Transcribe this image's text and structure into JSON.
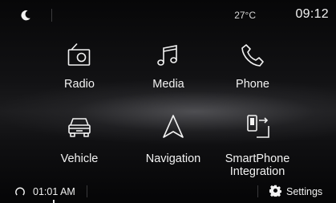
{
  "status": {
    "temperature": "27°C",
    "clock": "09:12"
  },
  "apps": [
    {
      "label": "Radio",
      "icon": "radio-icon"
    },
    {
      "label": "Media",
      "icon": "music-note-icon"
    },
    {
      "label": "Phone",
      "icon": "phone-icon"
    },
    {
      "label": "Vehicle",
      "icon": "car-icon"
    },
    {
      "label": "Navigation",
      "icon": "navigation-arrow-icon"
    },
    {
      "label": "SmartPhone\nIntegration",
      "icon": "smartphone-integration-icon"
    }
  ],
  "bottom": {
    "alarm_time": "01:01 AM",
    "settings_label": "Settings"
  },
  "colors": {
    "text": "#f2f2f2",
    "background": "#0b0b0c",
    "divider": "#3a3a3c"
  }
}
